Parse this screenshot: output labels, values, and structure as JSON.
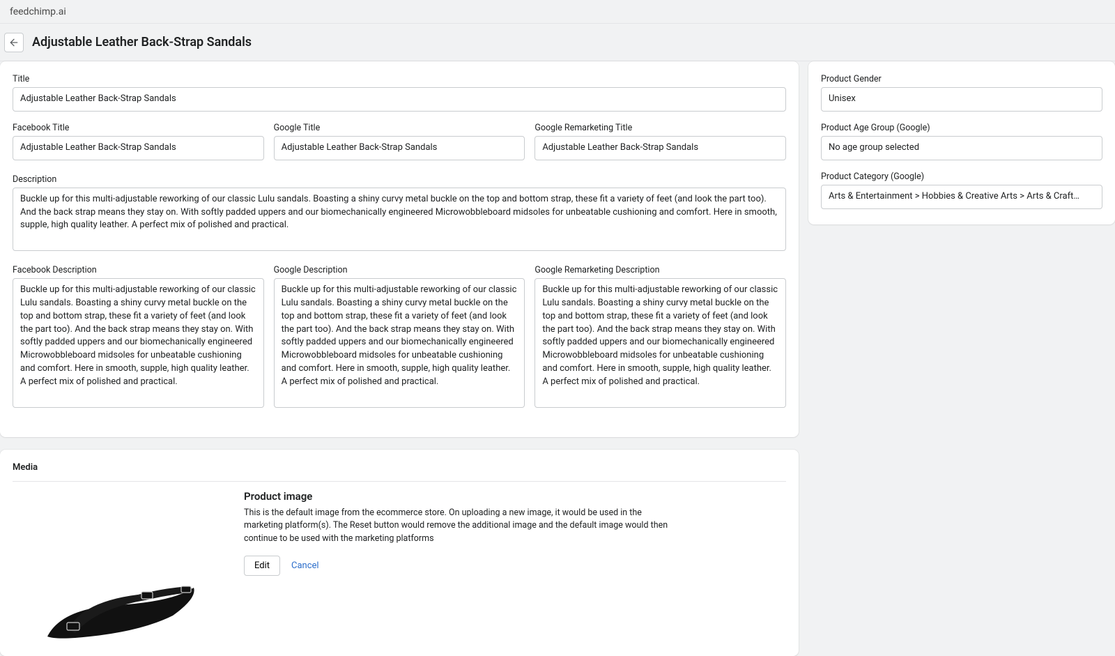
{
  "brand": "feedchimp.ai",
  "page_title": "Adjustable Leather Back-Strap Sandals",
  "main": {
    "title_label": "Title",
    "title_value": "Adjustable Leather Back-Strap Sandals",
    "fb_title_label": "Facebook Title",
    "fb_title_value": "Adjustable Leather Back-Strap Sandals",
    "g_title_label": "Google Title",
    "g_title_value": "Adjustable Leather Back-Strap Sandals",
    "gr_title_label": "Google Remarketing Title",
    "gr_title_value": "Adjustable Leather Back-Strap Sandals",
    "desc_label": "Description",
    "desc_value": "Buckle up for this multi-adjustable reworking of our classic Lulu sandals. Boasting a shiny curvy metal buckle on the top and bottom strap, these fit a variety of feet (and look the part too). And the back strap means they stay on. With softly padded uppers and our biomechanically engineered Microwobbleboard midsoles for unbeatable cushioning and comfort. Here in smooth, supple, high quality leather. A perfect mix of polished and practical.",
    "fb_desc_label": "Facebook Description",
    "fb_desc_value": "Buckle up for this multi-adjustable reworking of our classic Lulu sandals. Boasting a shiny curvy metal buckle on the top and bottom strap, these fit a variety of feet (and look the part too). And the back strap means they stay on. With softly padded uppers and our biomechanically engineered Microwobbleboard midsoles for unbeatable cushioning and comfort. Here in smooth, supple, high quality leather. A perfect mix of polished and practical.",
    "g_desc_label": "Google Description",
    "g_desc_value": "Buckle up for this multi-adjustable reworking of our classic Lulu sandals. Boasting a shiny curvy metal buckle on the top and bottom strap, these fit a variety of feet (and look the part too). And the back strap means they stay on. With softly padded uppers and our biomechanically engineered Microwobbleboard midsoles for unbeatable cushioning and comfort. Here in smooth, supple, high quality leather. A perfect mix of polished and practical.",
    "gr_desc_label": "Google Remarketing Description",
    "gr_desc_value": "Buckle up for this multi-adjustable reworking of our classic Lulu sandals. Boasting a shiny curvy metal buckle on the top and bottom strap, these fit a variety of feet (and look the part too). And the back strap means they stay on. With softly padded uppers and our biomechanically engineered Microwobbleboard midsoles for unbeatable cushioning and comfort. Here in smooth, supple, high quality leather. A perfect mix of polished and practical."
  },
  "sidebar": {
    "gender_label": "Product Gender",
    "gender_value": "Unisex",
    "age_label": "Product Age Group (Google)",
    "age_value": "No age group selected",
    "cat_label": "Product Category (Google)",
    "cat_value": "Arts & Entertainment > Hobbies & Creative Arts > Arts & Crafts > Art & Crafting Materials >"
  },
  "media": {
    "section_label": "Media",
    "heading": "Product image",
    "help": "This is the default image from the ecommerce store. On uploading a new image, it would be used in the marketing platform(s). The Reset button would remove the additional image and the default image would then continue to be used with the marketing platforms",
    "edit_label": "Edit",
    "cancel_label": "Cancel"
  }
}
